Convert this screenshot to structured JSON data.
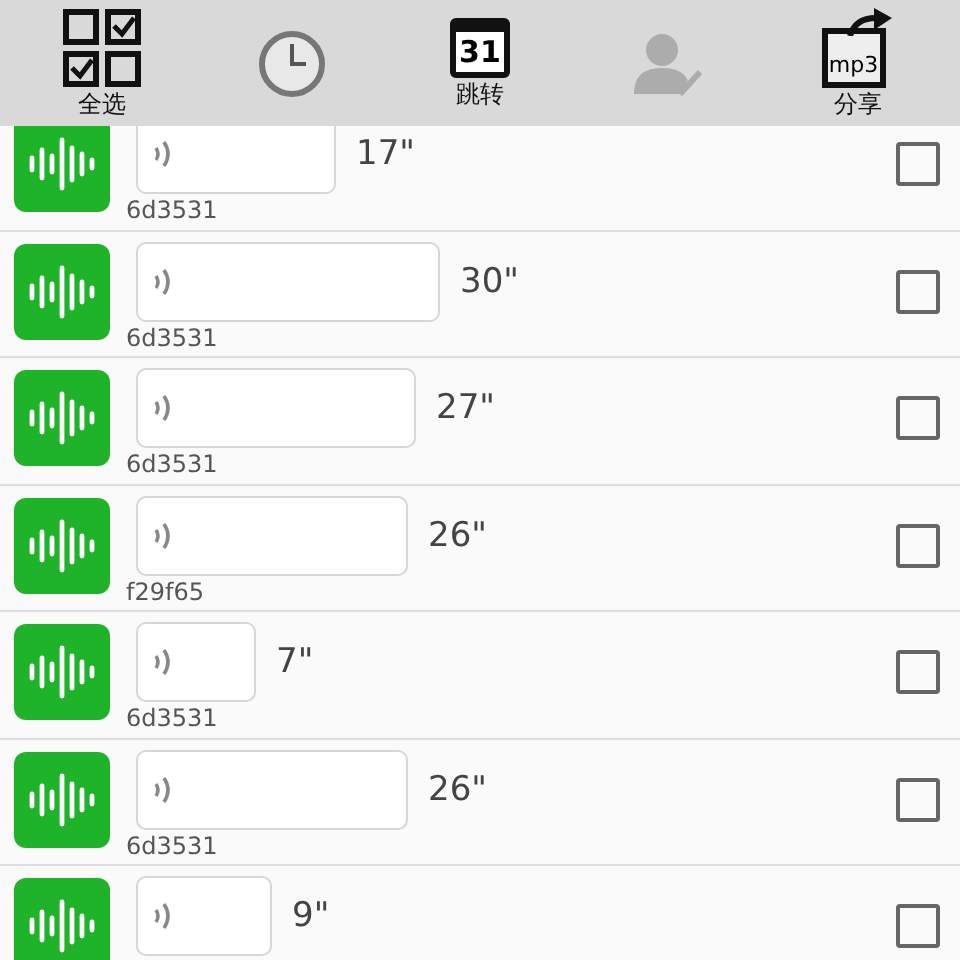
{
  "toolbar": [
    {
      "kind": "select_all",
      "label": "全选",
      "disabled": false
    },
    {
      "kind": "clock",
      "disabled": false
    },
    {
      "kind": "calendar",
      "icon_text": "31",
      "label": "跳转",
      "disabled": false
    },
    {
      "kind": "contact",
      "disabled": true
    },
    {
      "kind": "share",
      "icon_text": "mp3",
      "label": "分享",
      "disabled": false
    }
  ],
  "messages": [
    {
      "duration": "17\"",
      "sender": "6d3531",
      "checked": false
    },
    {
      "duration": "30\"",
      "sender": "6d3531",
      "checked": false
    },
    {
      "duration": "27\"",
      "sender": "6d3531",
      "checked": false
    },
    {
      "duration": "26\"",
      "sender": "f29f65",
      "checked": false
    },
    {
      "duration": "7\"",
      "sender": "6d3531",
      "checked": false
    },
    {
      "duration": "26\"",
      "sender": "6d3531",
      "checked": false
    },
    {
      "duration": "9\"",
      "checked": false
    }
  ]
}
